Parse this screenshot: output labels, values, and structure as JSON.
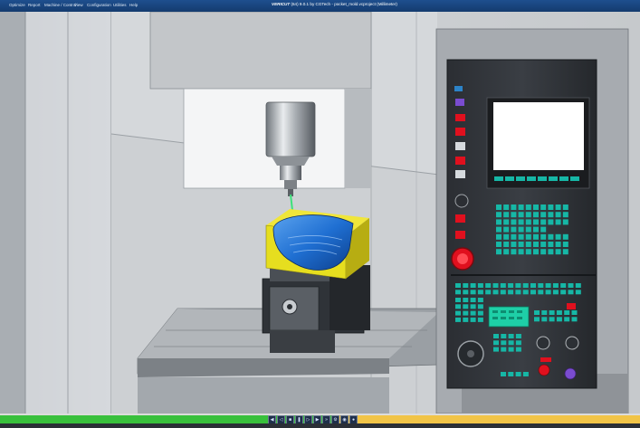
{
  "title": {
    "brand": "VERICUT",
    "text": "(64) 9.0.1 by CGTech - pocket_mold.vcproject (Millimeter)"
  },
  "menu": [
    {
      "label": "Optimize"
    },
    {
      "label": "Report"
    },
    {
      "label": "Machine / Control"
    },
    {
      "label": "View"
    },
    {
      "label": "Configuration"
    },
    {
      "label": "Utilities"
    },
    {
      "label": "Help"
    }
  ],
  "simulation": {
    "progress_fraction": 0.53
  },
  "playback_buttons": [
    {
      "name": "rewind-icon",
      "glyph": "◀"
    },
    {
      "name": "step-back-icon",
      "glyph": "◁"
    },
    {
      "name": "stop-icon",
      "glyph": "■"
    },
    {
      "name": "pause-icon",
      "glyph": "❚"
    },
    {
      "name": "step-icon",
      "glyph": "▷"
    },
    {
      "name": "play-icon",
      "glyph": "▶"
    },
    {
      "name": "fast-forward-icon",
      "glyph": "»"
    },
    {
      "name": "settings-icon",
      "glyph": "⚙"
    },
    {
      "name": "camera-icon",
      "glyph": "◉"
    },
    {
      "name": "record-icon",
      "glyph": "●"
    }
  ],
  "colors": {
    "titlebar": "#1e4f8e",
    "workpiece": "#e6de1f",
    "pocket": "#1f6fd2",
    "tool_path": "#3ce27a",
    "panel_screen": "#ffffff",
    "key_green": "#16b7a6",
    "key_red": "#e0101e",
    "key_purple": "#7a4cd0",
    "progress_green": "#39c03c",
    "progress_track": "#f1c447"
  }
}
